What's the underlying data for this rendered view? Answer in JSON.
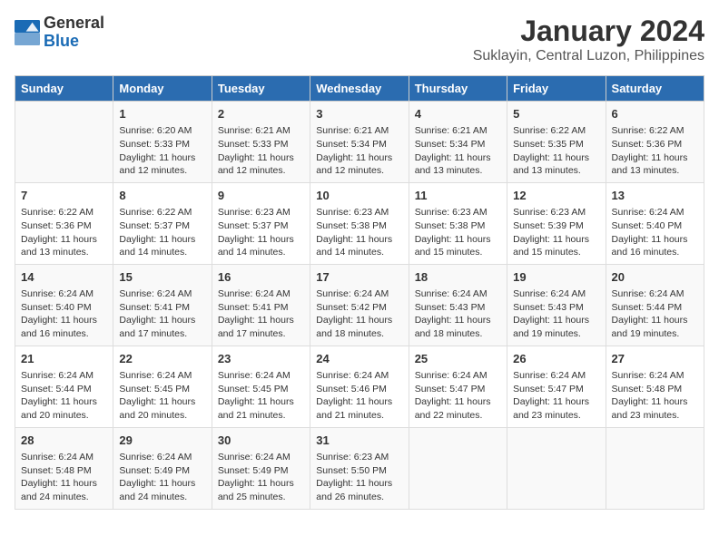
{
  "logo": {
    "general": "General",
    "blue": "Blue"
  },
  "title": "January 2024",
  "subtitle": "Suklayin, Central Luzon, Philippines",
  "weekdays": [
    "Sunday",
    "Monday",
    "Tuesday",
    "Wednesday",
    "Thursday",
    "Friday",
    "Saturday"
  ],
  "weeks": [
    [
      {
        "day": "",
        "info": ""
      },
      {
        "day": "1",
        "info": "Sunrise: 6:20 AM\nSunset: 5:33 PM\nDaylight: 11 hours\nand 12 minutes."
      },
      {
        "day": "2",
        "info": "Sunrise: 6:21 AM\nSunset: 5:33 PM\nDaylight: 11 hours\nand 12 minutes."
      },
      {
        "day": "3",
        "info": "Sunrise: 6:21 AM\nSunset: 5:34 PM\nDaylight: 11 hours\nand 12 minutes."
      },
      {
        "day": "4",
        "info": "Sunrise: 6:21 AM\nSunset: 5:34 PM\nDaylight: 11 hours\nand 13 minutes."
      },
      {
        "day": "5",
        "info": "Sunrise: 6:22 AM\nSunset: 5:35 PM\nDaylight: 11 hours\nand 13 minutes."
      },
      {
        "day": "6",
        "info": "Sunrise: 6:22 AM\nSunset: 5:36 PM\nDaylight: 11 hours\nand 13 minutes."
      }
    ],
    [
      {
        "day": "7",
        "info": "Sunrise: 6:22 AM\nSunset: 5:36 PM\nDaylight: 11 hours\nand 13 minutes."
      },
      {
        "day": "8",
        "info": "Sunrise: 6:22 AM\nSunset: 5:37 PM\nDaylight: 11 hours\nand 14 minutes."
      },
      {
        "day": "9",
        "info": "Sunrise: 6:23 AM\nSunset: 5:37 PM\nDaylight: 11 hours\nand 14 minutes."
      },
      {
        "day": "10",
        "info": "Sunrise: 6:23 AM\nSunset: 5:38 PM\nDaylight: 11 hours\nand 14 minutes."
      },
      {
        "day": "11",
        "info": "Sunrise: 6:23 AM\nSunset: 5:38 PM\nDaylight: 11 hours\nand 15 minutes."
      },
      {
        "day": "12",
        "info": "Sunrise: 6:23 AM\nSunset: 5:39 PM\nDaylight: 11 hours\nand 15 minutes."
      },
      {
        "day": "13",
        "info": "Sunrise: 6:24 AM\nSunset: 5:40 PM\nDaylight: 11 hours\nand 16 minutes."
      }
    ],
    [
      {
        "day": "14",
        "info": "Sunrise: 6:24 AM\nSunset: 5:40 PM\nDaylight: 11 hours\nand 16 minutes."
      },
      {
        "day": "15",
        "info": "Sunrise: 6:24 AM\nSunset: 5:41 PM\nDaylight: 11 hours\nand 17 minutes."
      },
      {
        "day": "16",
        "info": "Sunrise: 6:24 AM\nSunset: 5:41 PM\nDaylight: 11 hours\nand 17 minutes."
      },
      {
        "day": "17",
        "info": "Sunrise: 6:24 AM\nSunset: 5:42 PM\nDaylight: 11 hours\nand 18 minutes."
      },
      {
        "day": "18",
        "info": "Sunrise: 6:24 AM\nSunset: 5:43 PM\nDaylight: 11 hours\nand 18 minutes."
      },
      {
        "day": "19",
        "info": "Sunrise: 6:24 AM\nSunset: 5:43 PM\nDaylight: 11 hours\nand 19 minutes."
      },
      {
        "day": "20",
        "info": "Sunrise: 6:24 AM\nSunset: 5:44 PM\nDaylight: 11 hours\nand 19 minutes."
      }
    ],
    [
      {
        "day": "21",
        "info": "Sunrise: 6:24 AM\nSunset: 5:44 PM\nDaylight: 11 hours\nand 20 minutes."
      },
      {
        "day": "22",
        "info": "Sunrise: 6:24 AM\nSunset: 5:45 PM\nDaylight: 11 hours\nand 20 minutes."
      },
      {
        "day": "23",
        "info": "Sunrise: 6:24 AM\nSunset: 5:45 PM\nDaylight: 11 hours\nand 21 minutes."
      },
      {
        "day": "24",
        "info": "Sunrise: 6:24 AM\nSunset: 5:46 PM\nDaylight: 11 hours\nand 21 minutes."
      },
      {
        "day": "25",
        "info": "Sunrise: 6:24 AM\nSunset: 5:47 PM\nDaylight: 11 hours\nand 22 minutes."
      },
      {
        "day": "26",
        "info": "Sunrise: 6:24 AM\nSunset: 5:47 PM\nDaylight: 11 hours\nand 23 minutes."
      },
      {
        "day": "27",
        "info": "Sunrise: 6:24 AM\nSunset: 5:48 PM\nDaylight: 11 hours\nand 23 minutes."
      }
    ],
    [
      {
        "day": "28",
        "info": "Sunrise: 6:24 AM\nSunset: 5:48 PM\nDaylight: 11 hours\nand 24 minutes."
      },
      {
        "day": "29",
        "info": "Sunrise: 6:24 AM\nSunset: 5:49 PM\nDaylight: 11 hours\nand 24 minutes."
      },
      {
        "day": "30",
        "info": "Sunrise: 6:24 AM\nSunset: 5:49 PM\nDaylight: 11 hours\nand 25 minutes."
      },
      {
        "day": "31",
        "info": "Sunrise: 6:23 AM\nSunset: 5:50 PM\nDaylight: 11 hours\nand 26 minutes."
      },
      {
        "day": "",
        "info": ""
      },
      {
        "day": "",
        "info": ""
      },
      {
        "day": "",
        "info": ""
      }
    ]
  ]
}
